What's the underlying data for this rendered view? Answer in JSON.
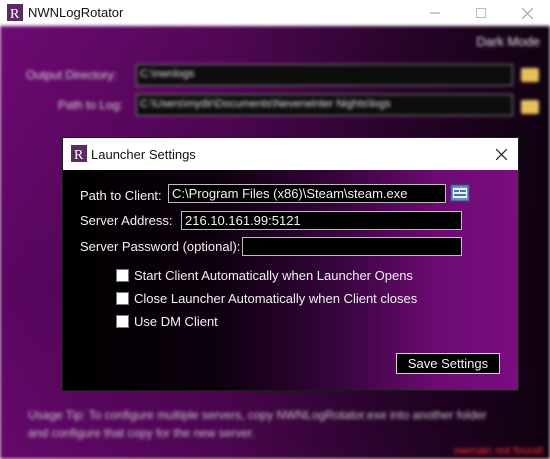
{
  "main_window": {
    "title": "NWNLogRotator",
    "theme_label": "Dark Mode",
    "output_directory": {
      "label": "Output Directory:",
      "value": "C:\\nwnlogs"
    },
    "path_to_log": {
      "label": "Path to Log:",
      "value": "C:\\Users\\mydir\\Documents\\Neverwinter Nights\\logs"
    },
    "usage_tip": "Usage Tip: To configure multiple servers, copy NWNLogRotator.exe into another folder and configure that copy for the new server.",
    "status_text": "nwmain not found!"
  },
  "dialog": {
    "title": "Launcher Settings",
    "path_to_client": {
      "label": "Path to Client:",
      "value": "C:\\Program Files (x86)\\Steam\\steam.exe"
    },
    "server_address": {
      "label": "Server Address:",
      "value": "216.10.161.99:5121"
    },
    "server_password": {
      "label": "Server Password (optional):",
      "value": ""
    },
    "options": [
      {
        "label": "Start Client Automatically when Launcher Opens",
        "checked": false
      },
      {
        "label": "Close Launcher Automatically when Client closes",
        "checked": false
      },
      {
        "label": "Use DM Client",
        "checked": false
      }
    ],
    "save_label": "Save Settings"
  },
  "icons": {
    "app": "nwn-r-logo-icon",
    "browse": "browse-file-icon",
    "folder": "folder-icon",
    "minimize": "minimize-icon",
    "maximize": "maximize-icon",
    "close": "close-icon"
  },
  "colors": {
    "accent_purple": "#7a0d80",
    "background_dark": "#000000",
    "status_red": "#ff2d2d"
  }
}
